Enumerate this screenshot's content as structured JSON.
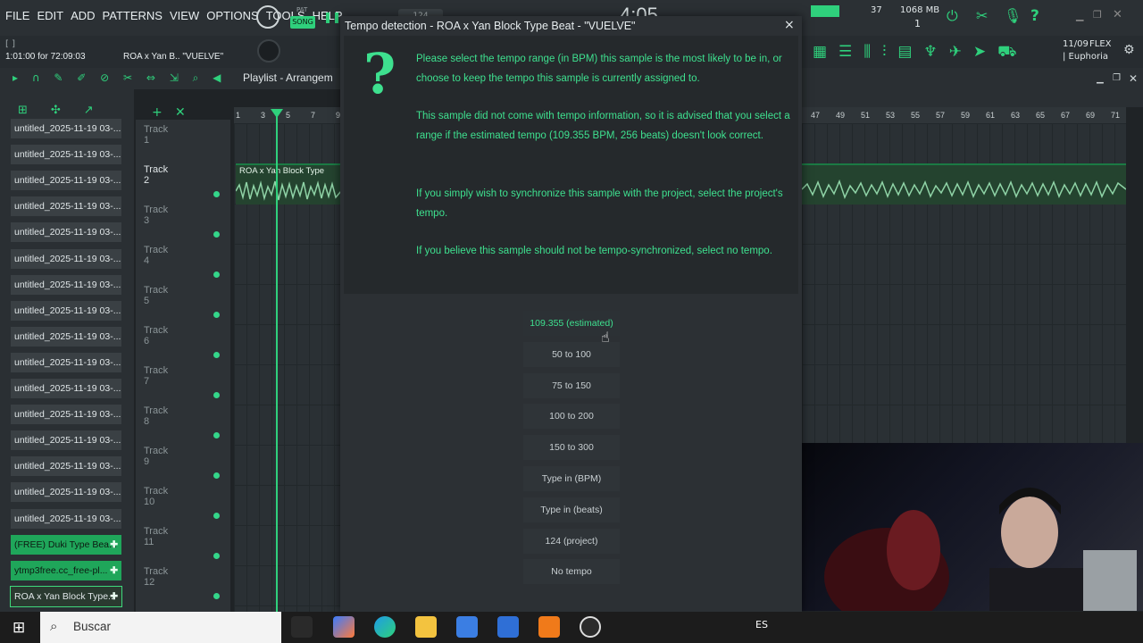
{
  "menu": [
    "FILE",
    "EDIT",
    "ADD",
    "PATTERNS",
    "VIEW",
    "OPTIONS",
    "TOOLS",
    "HELP"
  ],
  "transport": {
    "song_label": "SONG",
    "pat_label": "PAT",
    "tempo": "124",
    "time": "4:05",
    "cpu": "37",
    "mem": "1068 MB",
    "voices": "1"
  },
  "hints": {
    "top": "[ ]",
    "time_info": "1:01:00 for 72:09:03",
    "sample": "ROA x Yan B.. \"VUELVE\""
  },
  "plugin": {
    "date": "11/09",
    "name1": "FLEX",
    "name2": "| Euphoria"
  },
  "playlist": {
    "title": "Playlist - Arrangem"
  },
  "browser_items": [
    {
      "label": "untitled_2025-11-19 03-...",
      "kind": "gray"
    },
    {
      "label": "untitled_2025-11-19 03-...",
      "kind": "gray"
    },
    {
      "label": "untitled_2025-11-19 03-...",
      "kind": "gray"
    },
    {
      "label": "untitled_2025-11-19 03-...",
      "kind": "gray"
    },
    {
      "label": "untitled_2025-11-19 03-...",
      "kind": "gray"
    },
    {
      "label": "untitled_2025-11-19 03-...",
      "kind": "gray"
    },
    {
      "label": "untitled_2025-11-19 03-...",
      "kind": "gray"
    },
    {
      "label": "untitled_2025-11-19 03-...",
      "kind": "gray"
    },
    {
      "label": "untitled_2025-11-19 03-...",
      "kind": "gray"
    },
    {
      "label": "untitled_2025-11-19 03-...",
      "kind": "gray"
    },
    {
      "label": "untitled_2025-11-19 03-...",
      "kind": "gray"
    },
    {
      "label": "untitled_2025-11-19 03-...",
      "kind": "gray"
    },
    {
      "label": "untitled_2025-11-19 03-...",
      "kind": "gray"
    },
    {
      "label": "untitled_2025-11-19 03-...",
      "kind": "gray"
    },
    {
      "label": "untitled_2025-11-19 03-...",
      "kind": "gray"
    },
    {
      "label": "untitled_2025-11-19 03-...",
      "kind": "gray"
    },
    {
      "label": "(FREE) Duki Type Bea...",
      "kind": "green"
    },
    {
      "label": "ytmp3free.cc_free-pl...",
      "kind": "green"
    },
    {
      "label": "ROA x Yan Block Type...",
      "kind": "selected"
    }
  ],
  "tracks": [
    "Track 1",
    "Track 2",
    "Track 3",
    "Track 4",
    "Track 5",
    "Track 6",
    "Track 7",
    "Track 8",
    "Track 9",
    "Track 10",
    "Track 11",
    "Track 12"
  ],
  "ruler_left": [
    "1",
    "3",
    "5",
    "7",
    "9"
  ],
  "ruler_right": [
    "47",
    "49",
    "51",
    "53",
    "55",
    "57",
    "59",
    "61",
    "63",
    "65",
    "67",
    "69",
    "71"
  ],
  "clip_label": "ROA x Yan Block Type",
  "dialog": {
    "title": "Tempo detection - ROA x Yan Block Type Beat - \"VUELVE\"",
    "close": "×",
    "icon": "?",
    "para1": "Please select the tempo range (in BPM) this sample is the most likely to be in, or choose to keep the tempo this sample is currently assigned to.",
    "para2": "This sample did not come with tempo information, so it is advised that you select a range if the estimated tempo (109.355 BPM, 256 beats) doesn't look correct.",
    "para3": "If you simply wish to synchronize this sample with the project, select the project's tempo.",
    "para4": "If you believe this sample should not be tempo-synchronized, select no tempo.",
    "options": [
      "109.355 (estimated)",
      "50 to 100",
      "75 to 150",
      "100 to 200",
      "150 to 300",
      "Type in (BPM)",
      "Type in (beats)",
      "124 (project)",
      "No tempo"
    ]
  },
  "taskbar": {
    "search": "Buscar",
    "lang": "ES"
  },
  "colors": {
    "accent": "#3ee08f",
    "panel": "#2c3034",
    "clip": "#24432f"
  }
}
